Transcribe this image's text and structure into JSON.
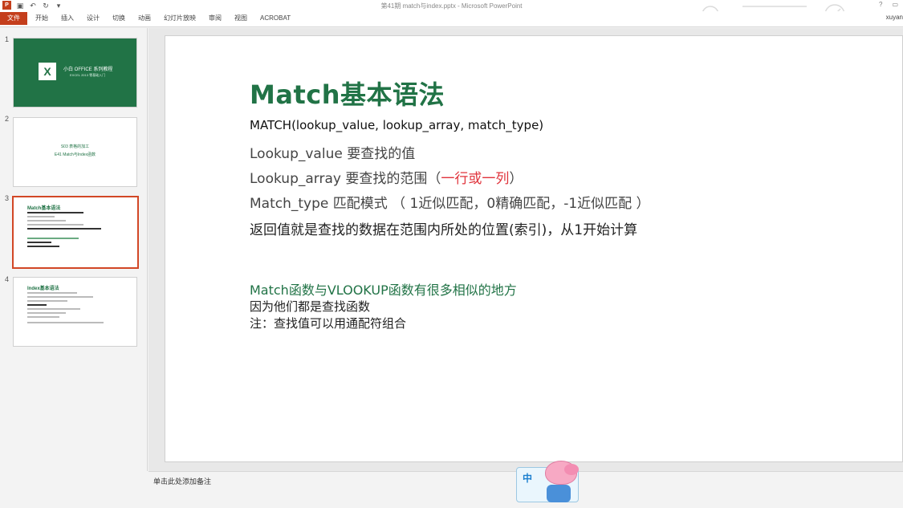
{
  "window": {
    "title": "第41期 match与index.pptx - Microsoft PowerPoint",
    "controls": [
      "?",
      "▭"
    ]
  },
  "quick_access": {
    "app_icon": "P",
    "icons": [
      "save-icon",
      "undo-icon",
      "redo-icon",
      "customize-icon"
    ]
  },
  "ribbon": {
    "tabs": [
      "文件",
      "开始",
      "插入",
      "设计",
      "切换",
      "动画",
      "幻灯片放映",
      "审阅",
      "视图",
      "ACROBAT"
    ],
    "user": "xuyan"
  },
  "thumbnails": [
    {
      "number": "1",
      "line1": "小白 OFFICE 系列教程",
      "line2": "EXCEL 2013 零基础入门"
    },
    {
      "number": "2",
      "line1": "S03    表格的加工",
      "line2": "E41  Match与Index函数"
    },
    {
      "number": "3",
      "line1": "Match基本语法"
    },
    {
      "number": "4",
      "line1": "Index基本语法"
    }
  ],
  "slide": {
    "title": "Match基本语法",
    "syntax": "MATCH(lookup_value, lookup_array, match_type)",
    "line1": "Lookup_value  要查找的值",
    "line2_prefix": "Lookup_array  要查找的范围（",
    "line2_red": "一行或一列",
    "line2_suffix": "）",
    "line3": "Match_type 匹配模式 （ 1近似匹配，0精确匹配，-1近似匹配 ）",
    "line4": "返回值就是查找的数据在范围内所处的位置(索引)，从1开始计算",
    "green_line": "Match函数与VLOOKUP函数有很多相似的地方",
    "note1": "因为他们都是查找函数",
    "note2": "注：查找值可以用通配符组合"
  },
  "notes": {
    "placeholder": "单击此处添加备注"
  },
  "ime": {
    "mode": "中"
  },
  "colors": {
    "accent_green": "#217346",
    "file_tab": "#c43e1c",
    "selection_border": "#d24726",
    "highlight_red": "#e0333b"
  }
}
